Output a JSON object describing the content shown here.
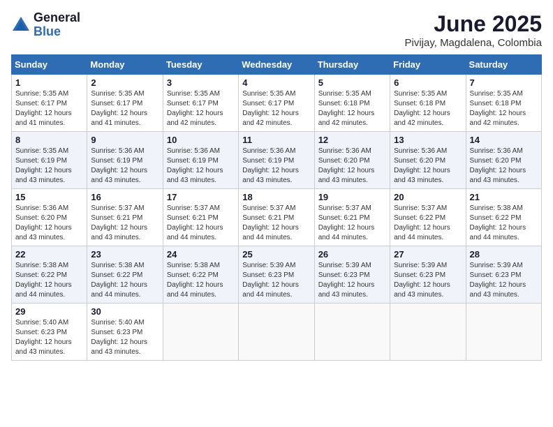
{
  "header": {
    "logo_general": "General",
    "logo_blue": "Blue",
    "month": "June 2025",
    "location": "Pivijay, Magdalena, Colombia"
  },
  "days_of_week": [
    "Sunday",
    "Monday",
    "Tuesday",
    "Wednesday",
    "Thursday",
    "Friday",
    "Saturday"
  ],
  "weeks": [
    [
      {
        "day": 1,
        "sunrise": "5:35 AM",
        "sunset": "6:17 PM",
        "daylight": "12 hours and 41 minutes"
      },
      {
        "day": 2,
        "sunrise": "5:35 AM",
        "sunset": "6:17 PM",
        "daylight": "12 hours and 41 minutes"
      },
      {
        "day": 3,
        "sunrise": "5:35 AM",
        "sunset": "6:17 PM",
        "daylight": "12 hours and 42 minutes"
      },
      {
        "day": 4,
        "sunrise": "5:35 AM",
        "sunset": "6:17 PM",
        "daylight": "12 hours and 42 minutes"
      },
      {
        "day": 5,
        "sunrise": "5:35 AM",
        "sunset": "6:18 PM",
        "daylight": "12 hours and 42 minutes"
      },
      {
        "day": 6,
        "sunrise": "5:35 AM",
        "sunset": "6:18 PM",
        "daylight": "12 hours and 42 minutes"
      },
      {
        "day": 7,
        "sunrise": "5:35 AM",
        "sunset": "6:18 PM",
        "daylight": "12 hours and 42 minutes"
      }
    ],
    [
      {
        "day": 8,
        "sunrise": "5:35 AM",
        "sunset": "6:19 PM",
        "daylight": "12 hours and 43 minutes"
      },
      {
        "day": 9,
        "sunrise": "5:36 AM",
        "sunset": "6:19 PM",
        "daylight": "12 hours and 43 minutes"
      },
      {
        "day": 10,
        "sunrise": "5:36 AM",
        "sunset": "6:19 PM",
        "daylight": "12 hours and 43 minutes"
      },
      {
        "day": 11,
        "sunrise": "5:36 AM",
        "sunset": "6:19 PM",
        "daylight": "12 hours and 43 minutes"
      },
      {
        "day": 12,
        "sunrise": "5:36 AM",
        "sunset": "6:20 PM",
        "daylight": "12 hours and 43 minutes"
      },
      {
        "day": 13,
        "sunrise": "5:36 AM",
        "sunset": "6:20 PM",
        "daylight": "12 hours and 43 minutes"
      },
      {
        "day": 14,
        "sunrise": "5:36 AM",
        "sunset": "6:20 PM",
        "daylight": "12 hours and 43 minutes"
      }
    ],
    [
      {
        "day": 15,
        "sunrise": "5:36 AM",
        "sunset": "6:20 PM",
        "daylight": "12 hours and 43 minutes"
      },
      {
        "day": 16,
        "sunrise": "5:37 AM",
        "sunset": "6:21 PM",
        "daylight": "12 hours and 43 minutes"
      },
      {
        "day": 17,
        "sunrise": "5:37 AM",
        "sunset": "6:21 PM",
        "daylight": "12 hours and 44 minutes"
      },
      {
        "day": 18,
        "sunrise": "5:37 AM",
        "sunset": "6:21 PM",
        "daylight": "12 hours and 44 minutes"
      },
      {
        "day": 19,
        "sunrise": "5:37 AM",
        "sunset": "6:21 PM",
        "daylight": "12 hours and 44 minutes"
      },
      {
        "day": 20,
        "sunrise": "5:37 AM",
        "sunset": "6:22 PM",
        "daylight": "12 hours and 44 minutes"
      },
      {
        "day": 21,
        "sunrise": "5:38 AM",
        "sunset": "6:22 PM",
        "daylight": "12 hours and 44 minutes"
      }
    ],
    [
      {
        "day": 22,
        "sunrise": "5:38 AM",
        "sunset": "6:22 PM",
        "daylight": "12 hours and 44 minutes"
      },
      {
        "day": 23,
        "sunrise": "5:38 AM",
        "sunset": "6:22 PM",
        "daylight": "12 hours and 44 minutes"
      },
      {
        "day": 24,
        "sunrise": "5:38 AM",
        "sunset": "6:22 PM",
        "daylight": "12 hours and 44 minutes"
      },
      {
        "day": 25,
        "sunrise": "5:39 AM",
        "sunset": "6:23 PM",
        "daylight": "12 hours and 44 minutes"
      },
      {
        "day": 26,
        "sunrise": "5:39 AM",
        "sunset": "6:23 PM",
        "daylight": "12 hours and 43 minutes"
      },
      {
        "day": 27,
        "sunrise": "5:39 AM",
        "sunset": "6:23 PM",
        "daylight": "12 hours and 43 minutes"
      },
      {
        "day": 28,
        "sunrise": "5:39 AM",
        "sunset": "6:23 PM",
        "daylight": "12 hours and 43 minutes"
      }
    ],
    [
      {
        "day": 29,
        "sunrise": "5:40 AM",
        "sunset": "6:23 PM",
        "daylight": "12 hours and 43 minutes"
      },
      {
        "day": 30,
        "sunrise": "5:40 AM",
        "sunset": "6:23 PM",
        "daylight": "12 hours and 43 minutes"
      },
      null,
      null,
      null,
      null,
      null
    ]
  ]
}
